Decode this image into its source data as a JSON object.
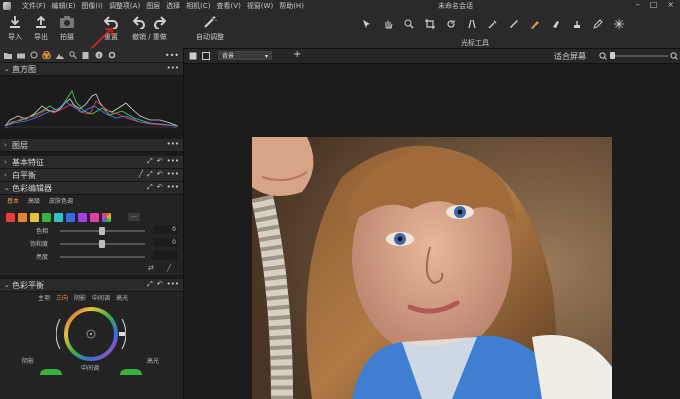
{
  "menu": {
    "items": [
      "文件(F)",
      "编辑(E)",
      "图像(I)",
      "调整项(A)",
      "图层",
      "选择",
      "相机(C)",
      "查看(V)",
      "视窗(W)",
      "帮助(H)"
    ],
    "title": "未命名会话"
  },
  "toolbar": {
    "import": "导入",
    "export": "导出",
    "capture": "拍摄",
    "reset": "重置",
    "undo_redo": "撤销 / 重做",
    "auto_adjust": "自动调整",
    "cursor_tools_label": "光标工具"
  },
  "sidebar": {
    "histogram_title": "直方图",
    "layers_title": "图层",
    "basic_title": "基本特征",
    "wb_title": "白平衡",
    "color_editor_title": "色彩编辑器",
    "color_editor_tabs": [
      "基本",
      "高级",
      "皮肤色调"
    ],
    "swatch_colors": [
      "#e0403a",
      "#e0843a",
      "#e0c43a",
      "#3ab040",
      "#3ac0c0",
      "#3a6ae0",
      "#a040e0",
      "#e040a0"
    ],
    "sliders": [
      {
        "label": "色相",
        "value": "0",
        "level": 0.5
      },
      {
        "label": "饱和度",
        "value": "0",
        "level": 0.5
      },
      {
        "label": "亮度",
        "value": "",
        "level": 0.5
      }
    ],
    "color_balance_title": "色彩平衡",
    "color_balance_modes": [
      "主项",
      "三向",
      "阴影",
      "中间调",
      "高光"
    ],
    "shadow": "阴影",
    "midtone": "中间调",
    "highlight": "高光"
  },
  "viewer": {
    "background_select": "背景",
    "fit_label": "适合屏幕"
  },
  "colors": {
    "accent": "#f19a3e",
    "annotation": "#e02020"
  }
}
